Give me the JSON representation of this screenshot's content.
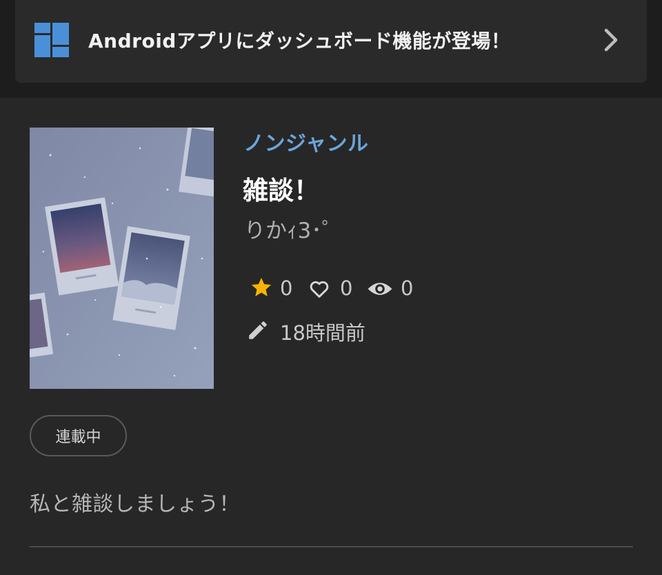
{
  "banner": {
    "text": "Androidアプリにダッシュボード機能が登場！",
    "icon": "dashboard-icon",
    "chevron_icon": "chevron-right-icon"
  },
  "story": {
    "genre": "ノンジャンル",
    "title": "雑談！",
    "author": "りかｨ3･゜",
    "stats": {
      "stars": "0",
      "likes": "0",
      "views": "0"
    },
    "updated": "18時間前",
    "status": "連載中",
    "description": "私と雑談しましょう！"
  },
  "colors": {
    "background": "#272727",
    "genre_accent": "#6aa6da",
    "star": "#f6b400",
    "dashboard_icon": "#4a90d9"
  }
}
